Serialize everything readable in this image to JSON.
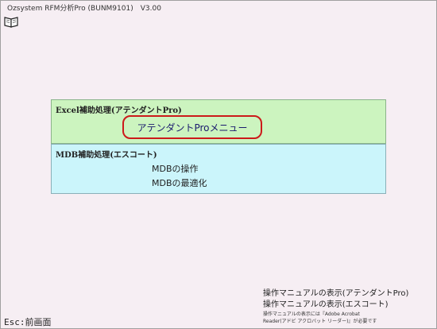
{
  "window": {
    "title": "Ozsystem RFM分析Pro (BUNM9101)　V3.00",
    "background": "#f6eef3"
  },
  "toolbar": {
    "icon": "book-icon"
  },
  "excel_panel": {
    "title": "Excel補助処理(アテンダントPro)",
    "menu_button": "アテンダントProメニュー",
    "background": "#ccf4bf",
    "highlight_color": "#cc1a1a"
  },
  "mdb_panel": {
    "title": "MDB補助処理(エスコート)",
    "operation_button": "MDBの操作",
    "optimize_button": "MDBの最適化",
    "background": "#cbf5fb"
  },
  "manual": {
    "attendant_link": "操作マニュアルの表示(アテンダントPro)",
    "escort_link": "操作マニュアルの表示(エスコート)",
    "note_line1": "操作マニュアルの表示には『Adobe Acrobat",
    "note_line2": "Reader(アドビ アクロバット リーダー)』が必要です"
  },
  "footer": {
    "esc_label": "Esc:前画面"
  }
}
